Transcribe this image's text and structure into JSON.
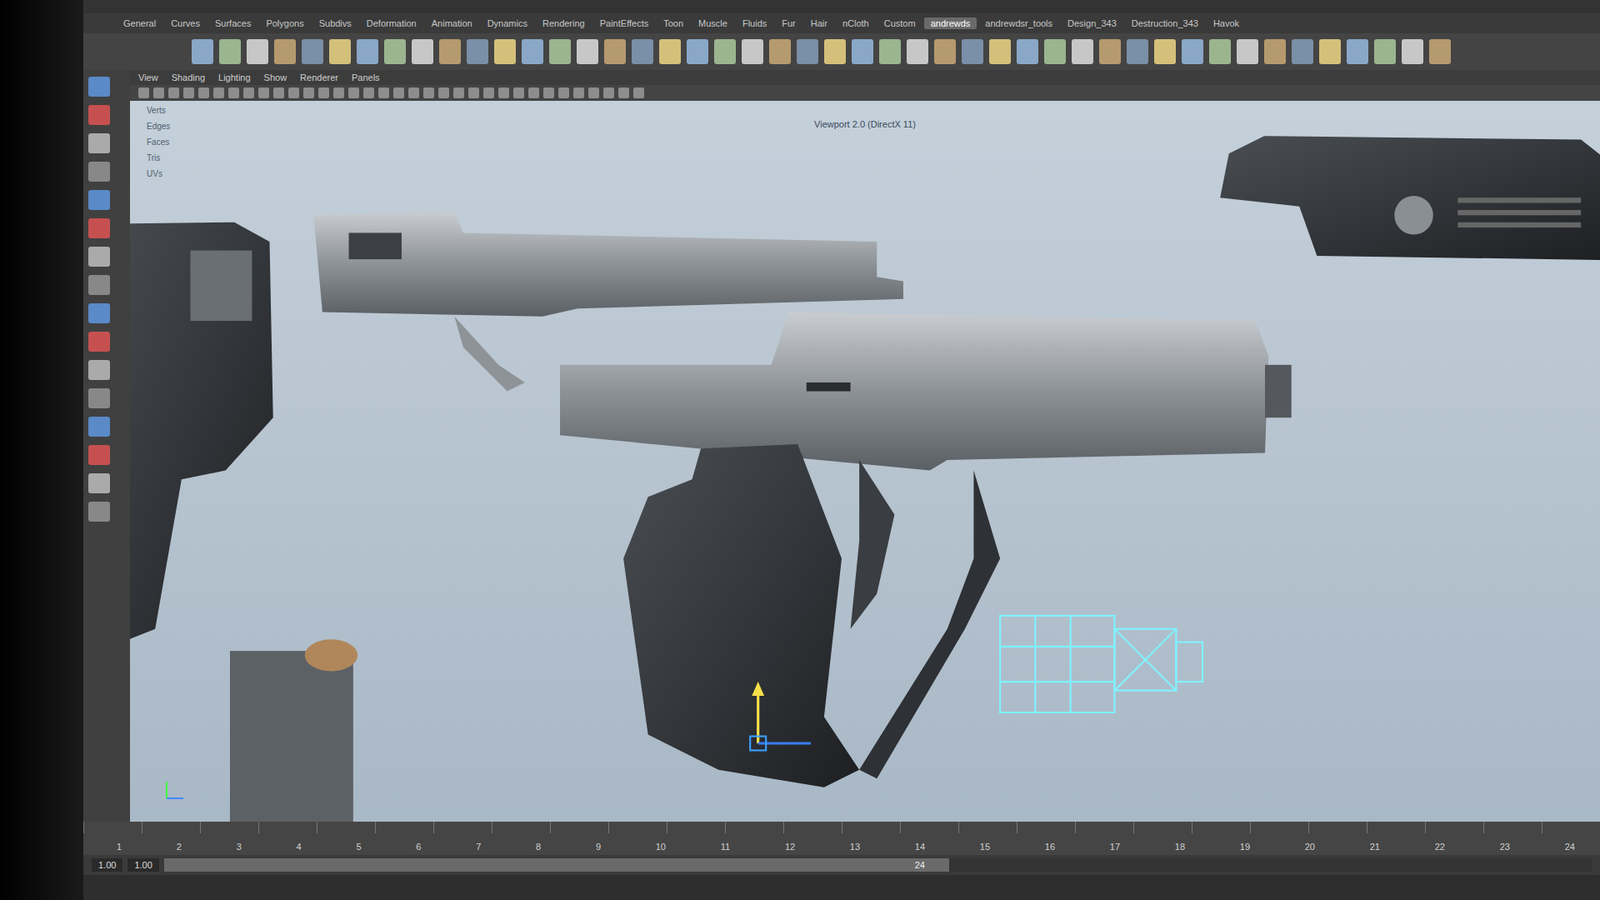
{
  "app": "Maya",
  "shelf_tabs": [
    {
      "label": "General",
      "selected": false
    },
    {
      "label": "Curves",
      "selected": false
    },
    {
      "label": "Surfaces",
      "selected": false
    },
    {
      "label": "Polygons",
      "selected": false
    },
    {
      "label": "Subdivs",
      "selected": false
    },
    {
      "label": "Deformation",
      "selected": false
    },
    {
      "label": "Animation",
      "selected": false
    },
    {
      "label": "Dynamics",
      "selected": false
    },
    {
      "label": "Rendering",
      "selected": false
    },
    {
      "label": "PaintEffects",
      "selected": false
    },
    {
      "label": "Toon",
      "selected": false
    },
    {
      "label": "Muscle",
      "selected": false
    },
    {
      "label": "Fluids",
      "selected": false
    },
    {
      "label": "Fur",
      "selected": false
    },
    {
      "label": "Hair",
      "selected": false
    },
    {
      "label": "nCloth",
      "selected": false
    },
    {
      "label": "Custom",
      "selected": false
    },
    {
      "label": "andrewds",
      "selected": true
    },
    {
      "label": "andrewdsr_tools",
      "selected": false
    },
    {
      "label": "Design_343",
      "selected": false
    },
    {
      "label": "Destruction_343",
      "selected": false
    },
    {
      "label": "Havok",
      "selected": false
    }
  ],
  "panel_menu": [
    "View",
    "Shading",
    "Lighting",
    "Show",
    "Renderer",
    "Panels"
  ],
  "viewport": {
    "label": "Viewport 2.0 (DirectX 11)"
  },
  "hud_stats": [
    "Verts",
    "Edges",
    "Faces",
    "Tris",
    "UVs"
  ],
  "timeline": {
    "ticks": [
      "1",
      "2",
      "3",
      "4",
      "5",
      "6",
      "7",
      "8",
      "9",
      "10",
      "11",
      "12",
      "13",
      "14",
      "15",
      "16",
      "17",
      "18",
      "19",
      "20",
      "21",
      "22",
      "23",
      "24"
    ]
  },
  "range": {
    "start": "1.00",
    "inner_start": "1.00",
    "end": "24"
  }
}
